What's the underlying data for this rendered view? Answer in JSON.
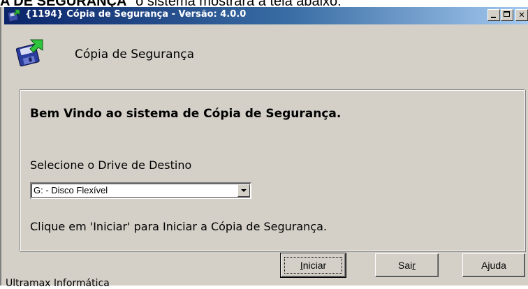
{
  "page_caption": {
    "bold_part": "A DE SEGURANÇA",
    "rest": "\" o sistema mostrará a tela abaixo:"
  },
  "window": {
    "title": "{1194} Cópia de Segurança - Versão: 4.0.0",
    "icon": "backup-disk-icon",
    "caption_buttons": [
      "minimize",
      "maximize",
      "close"
    ]
  },
  "header": {
    "title": "Cópia de Segurança",
    "icon": "backup-disk-icon"
  },
  "main": {
    "welcome": "Bem Vindo ao sistema de Cópia de Segurança.",
    "drive_label": "Selecione o Drive de Destino",
    "drive_selected": "G: - Disco Flexível",
    "instruction": "Clique em 'Iniciar' para Iniciar a Cópia de Segurança."
  },
  "buttons": {
    "start_first": "I",
    "start_rest": "niciar",
    "exit_first": "Sai",
    "exit_u": "r",
    "help": "Ajuda"
  },
  "footer": {
    "company": "Ultramax Informática"
  },
  "colors": {
    "title_bar_start": "#0a246a",
    "title_bar_end": "#a6caf0",
    "window_face": "#d4d0c8"
  }
}
